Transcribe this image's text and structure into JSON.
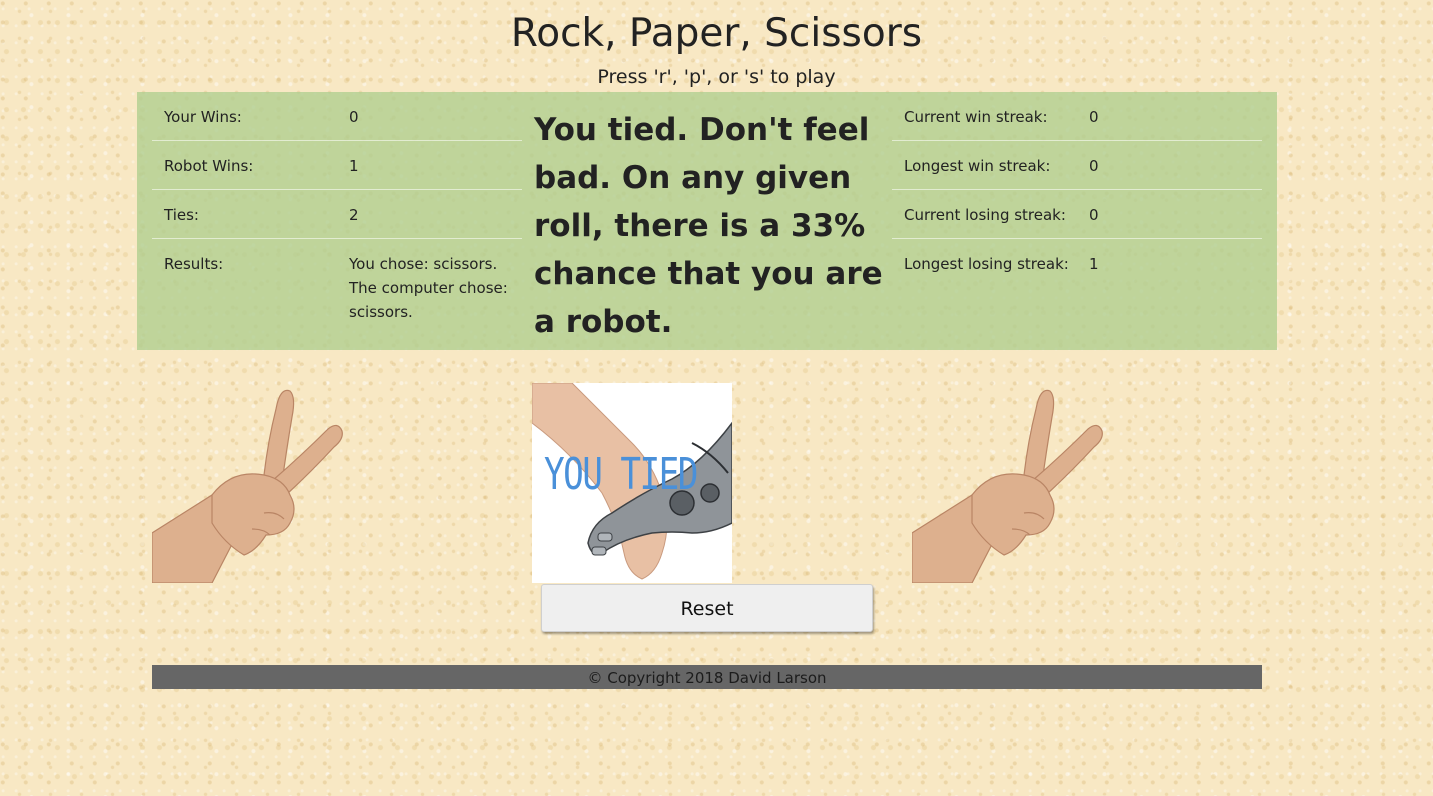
{
  "page": {
    "title": "Rock, Paper, Scissors",
    "instructions": "Press 'r', 'p', or 's' to play"
  },
  "left_stats": [
    {
      "label": "Your Wins:",
      "value": "0"
    },
    {
      "label": "Robot Wins:",
      "value": "1"
    },
    {
      "label": "Ties:",
      "value": "2"
    }
  ],
  "results": {
    "label": "Results:",
    "line1": "You chose: scissors.",
    "line2": "The computer chose: scissors."
  },
  "right_stats": [
    {
      "label": "Current win streak:",
      "value": "0"
    },
    {
      "label": "Longest win streak:",
      "value": "0"
    },
    {
      "label": "Current losing streak:",
      "value": "0"
    },
    {
      "label": "Longest losing streak:",
      "value": "1"
    }
  ],
  "message": "You tied. Don't feel bad. On any given roll, there is a 33% chance that you are a robot.",
  "images": {
    "player_choice_icon": "scissors-hand-icon",
    "computer_choice_icon": "scissors-hand-icon",
    "result_overlay_text": "YOU TIED"
  },
  "reset_label": "Reset",
  "footer": "© Copyright 2018 David Larson",
  "colors": {
    "background": "#f8e8c4",
    "panel": "#b5d098",
    "footer": "#666666",
    "overlay_text": "#4a90d9"
  }
}
